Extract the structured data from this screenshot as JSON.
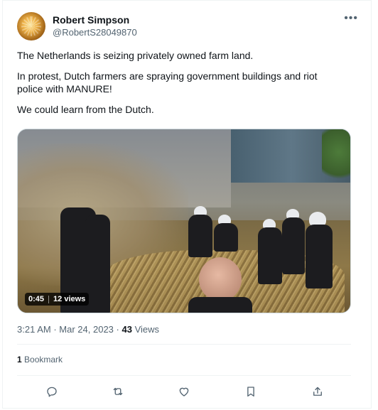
{
  "tweet": {
    "author_name": "Robert Simpson",
    "author_handle": "@RobertS28049870",
    "more_icon": "more-horizontal-icon",
    "text_lines": [
      "The Netherlands is seizing privately owned farm land.",
      "In protest, Dutch farmers are spraying government buildings and riot\npolice with MANURE!",
      "We could learn from the Dutch."
    ],
    "video": {
      "duration": "0:45",
      "views": "12 views"
    },
    "time": "3:21 AM",
    "separator": "·",
    "date": "Mar 24, 2023",
    "views_count": "43",
    "views_label": "Views",
    "bookmark_count": "1",
    "bookmark_label": "Bookmark",
    "actions": [
      {
        "icon": "reply-icon"
      },
      {
        "icon": "retweet-icon"
      },
      {
        "icon": "like-icon"
      },
      {
        "icon": "bookmark-icon"
      },
      {
        "icon": "share-icon"
      }
    ]
  },
  "colors": {
    "text_primary": "#0f1419",
    "text_secondary": "#536471",
    "border": "#eff3f4"
  }
}
